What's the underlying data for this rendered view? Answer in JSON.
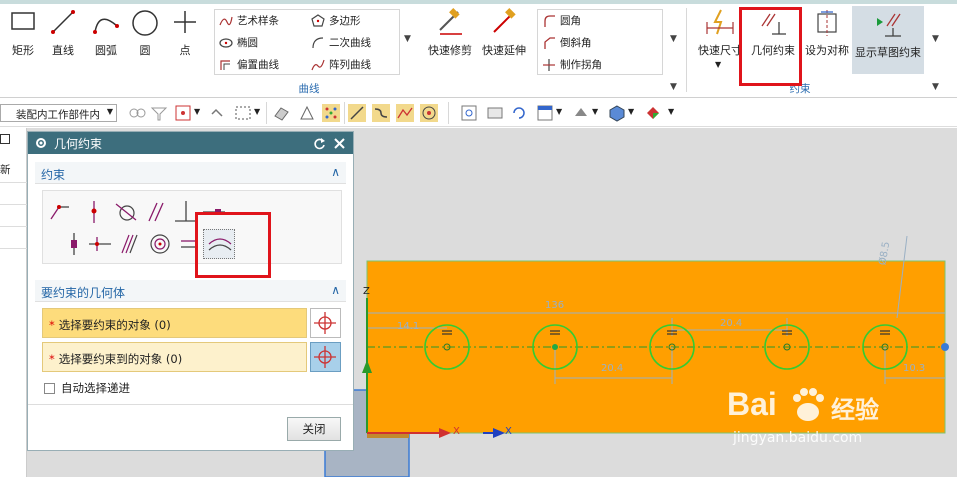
{
  "ribbon": {
    "buttons_left": [
      {
        "label": "矩形",
        "icon": "rectangle-icon"
      },
      {
        "label": "直线",
        "icon": "line-icon"
      },
      {
        "label": "圆弧",
        "icon": "arc-icon"
      },
      {
        "label": "圆",
        "icon": "circle-icon"
      },
      {
        "label": "点",
        "icon": "point-icon"
      }
    ],
    "curve_group": {
      "label": "曲线",
      "col1": [
        "艺术样条",
        "椭圆",
        "偏置曲线"
      ],
      "col2": [
        "多边形",
        "二次曲线",
        "阵列曲线"
      ]
    },
    "edit_buttons": [
      {
        "label": "快速修剪",
        "icon": "quick-trim-icon"
      },
      {
        "label": "快速延伸",
        "icon": "quick-extend-icon"
      }
    ],
    "corner_group": [
      "圆角",
      "倒斜角",
      "制作拐角"
    ],
    "constraint_group": {
      "label": "约束",
      "buttons": [
        {
          "label": "快速尺寸",
          "icon": "rapid-dimension-icon"
        },
        {
          "label": "几何约束",
          "icon": "geometric-constraint-icon"
        },
        {
          "label": "设为对称",
          "icon": "make-symmetric-icon"
        },
        {
          "label": "显示草图约束",
          "icon": "show-sketch-constraints-icon"
        }
      ]
    }
  },
  "toolbar": {
    "scope_value": "整个装配内工作部件内"
  },
  "leftnav": {
    "header_glyph": "新"
  },
  "dialog": {
    "title": "几何约束",
    "section1_title": "约束",
    "section2_title": "要约束的几何体",
    "select_object": "选择要约束的对象 (0)",
    "select_target": "选择要约束到的对象 (0)",
    "auto_select": "自动选择递进",
    "close_button": "关闭"
  },
  "drawing": {
    "dim_136": "136",
    "dim_14_1": "14.1",
    "dim_20_4_top": "20.4",
    "dim_20_4_bottom": "20.4",
    "dim_10_3": "10.3",
    "dim_d8_5": "Ø8.5",
    "axis_z": "Z",
    "axis_x": "X",
    "axis_x2": "X"
  },
  "watermark": {
    "brand": "Bai",
    "brand2": "经验",
    "url": "jingyan.baidu.com"
  },
  "colors": {
    "accent": "#2466a6",
    "title_bar": "#3d6e7d",
    "part_fill": "#ff9f00",
    "highlight": "#e0141b",
    "circle": "#33cc33"
  }
}
